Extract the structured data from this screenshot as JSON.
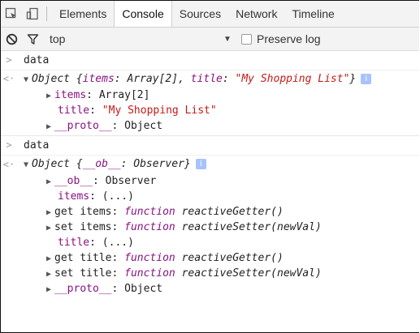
{
  "tabs": [
    "Elements",
    "Console",
    "Sources",
    "Network",
    "Timeline"
  ],
  "active_tab": "Console",
  "toolbar": {
    "context": "top",
    "preserve_log": "Preserve log"
  },
  "icons": {
    "inspect": "inspect-element-icon",
    "device": "device-mode-icon",
    "clear": "clear-console-icon",
    "filter": "filter-icon",
    "dropdown": "dropdown-arrow",
    "info": "info-icon"
  },
  "entries": [
    {
      "input": "data",
      "object": {
        "prefix": "Object {",
        "k1": "items",
        "v1": "Array[2]",
        "k2": "title",
        "v2": "\"My Shopping List\"",
        "suffix": "}"
      },
      "props": {
        "items_key": "items",
        "items_val": "Array[2]",
        "title_key": "title",
        "title_val": "\"My Shopping List\"",
        "proto_key": "__proto__",
        "proto_val": "Object"
      }
    },
    {
      "input": "data",
      "object": {
        "prefix": "Object {",
        "k1": "__ob__",
        "v1": "Observer",
        "suffix": "}"
      },
      "props": {
        "ob_key": "__ob__",
        "ob_val": "Observer",
        "items_key": "items",
        "items_val": "(...)",
        "get_items": "get items",
        "set_items": "set items",
        "title_key": "title",
        "title_val": "(...)",
        "get_title": "get title",
        "set_title": "set title",
        "fn_kw": "function",
        "getter": "reactiveGetter()",
        "setter": "reactiveSetter(newVal)",
        "proto_key": "__proto__",
        "proto_val": "Object"
      }
    }
  ],
  "colors": {
    "key": "#881280",
    "string": "#c41a16",
    "info_badge": "#a7c2ff"
  }
}
